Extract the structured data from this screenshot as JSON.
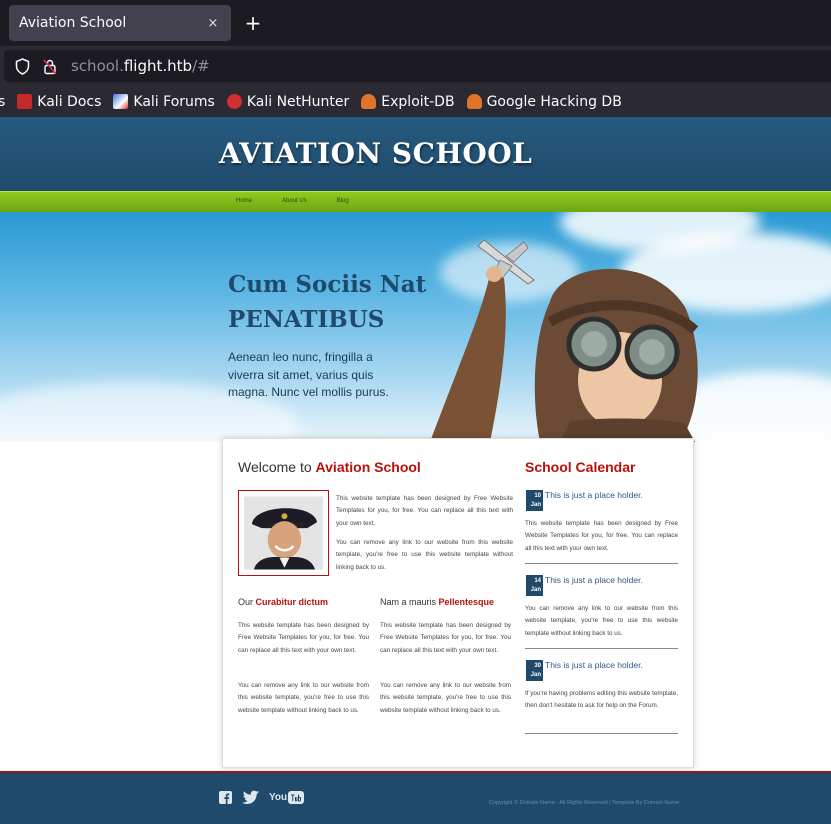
{
  "browser": {
    "tab_title": "Aviation School",
    "tab_close": "×",
    "new_tab": "+",
    "url_scheme_part": "school.",
    "url_host": "flight.htb",
    "url_path": "/#"
  },
  "bookmarks": [
    {
      "label": "Kali Docs",
      "icon": "kali-docs-icon",
      "color": "#c42a2a"
    },
    {
      "label": "Kali Forums",
      "icon": "kali-forums-icon",
      "color": "#3a6fd8"
    },
    {
      "label": "Kali NetHunter",
      "icon": "kali-nethunter-icon",
      "color": "#d13030"
    },
    {
      "label": "Exploit-DB",
      "icon": "exploit-db-icon",
      "color": "#e0742a"
    },
    {
      "label": "Google Hacking DB",
      "icon": "ghdb-icon",
      "color": "#e0742a"
    }
  ],
  "bookmark_cut": "s",
  "site": {
    "logo": "AVIATION SCHOOL",
    "menu": [
      "Home",
      "About Us",
      "Blog"
    ],
    "hero": {
      "title_line1": "Cum Sociis Nat",
      "title_line2": "PENATIBUS",
      "text": "Aenean leo nunc, fringilla a viverra sit amet, varius quis magna. Nunc vel mollis purus."
    },
    "welcome": {
      "prefix": "Welcome to ",
      "highlight": "Aviation School",
      "p1": "This website template has been designed by Free Website Templates for you, for free. You can replace all this text with your own text.",
      "p2": "You can remove any link to our website from this website template, you're free to use this website template without linking back to us."
    },
    "col1": {
      "prefix": "Our ",
      "highlight": "Curabitur dictum",
      "p1": "This website template has been designed by Free Website Templates for you, for free. You can replace all this text with your own text.",
      "p2": "You can remove any link to our website from this website template, you're free to use this website template without linking back to us."
    },
    "col2": {
      "prefix": "Nam a mauris ",
      "highlight": "Pellentesque",
      "p1": "This website template has been designed by Free Website Templates for you, for free. You can replace all this text with your own text.",
      "p2": "You can remove any link to our website from this website template, you're free to use this website template without linking back to us."
    },
    "calendar": {
      "title": "School Calendar",
      "events": [
        {
          "day": "10",
          "month": "Jan",
          "title": "This is just a place holder.",
          "text": "This website template has been designed by Free Website Templates for you, for free. You can replace all this text with your own text."
        },
        {
          "day": "14",
          "month": "Jan",
          "title": "This is just a place holder.",
          "text": "You can remove any link to our website from this website template, you're free to use this website template without linking back to us."
        },
        {
          "day": "30",
          "month": "Jan",
          "title": "This is just a place holder.",
          "text": "If you're having problems editing this website template, then don't hesitate to ask for help on the Forum."
        }
      ]
    },
    "footer": {
      "copyright": "Copyright © Domain Name - All Rights Reserved | Template By Domain Name",
      "social": [
        "facebook-icon",
        "twitter-icon",
        "youtube-icon"
      ],
      "youtube_label": "You"
    },
    "colors": {
      "accent_red": "#b8100d",
      "header_blue": "#1f4a6b",
      "menu_green": "#7ab817"
    }
  }
}
